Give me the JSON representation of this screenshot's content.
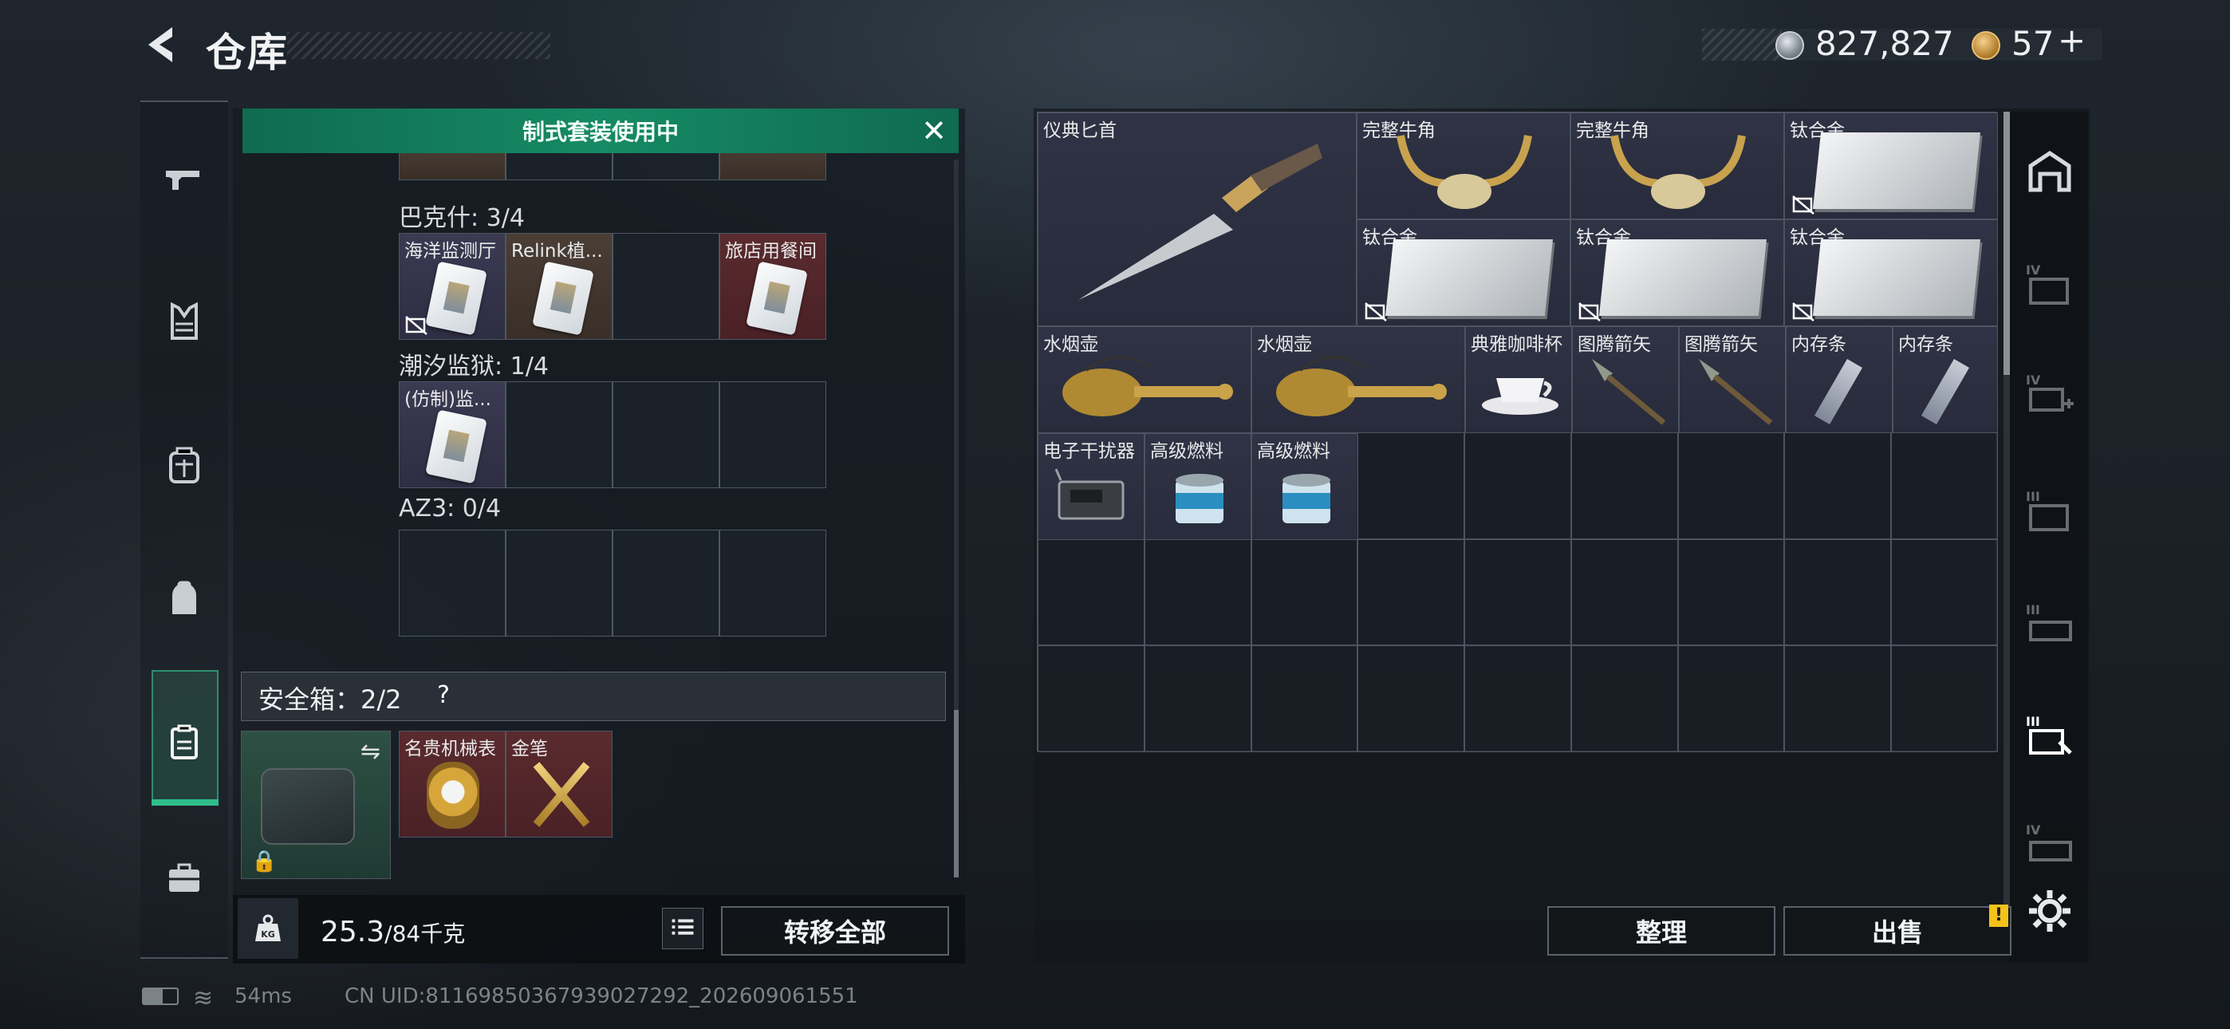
{
  "header": {
    "title": "仓库",
    "currency_silver": "827,827",
    "currency_gold": "57",
    "gold_plus": "+"
  },
  "banner": {
    "text": "制式套装使用中"
  },
  "sets": [
    {
      "label": "巴克什: 3/4",
      "items": [
        {
          "name": "海洋监测厅",
          "bg": "purple",
          "locked_off": true
        },
        {
          "name": "Relink植...",
          "bg": "brown"
        },
        {
          "name": "",
          "bg": "empty"
        },
        {
          "name": "旅店用餐间",
          "bg": "red"
        }
      ]
    },
    {
      "label": "潮汐监狱: 1/4",
      "items": [
        {
          "name": "(仿制)监...",
          "bg": "purple"
        },
        {
          "name": "",
          "bg": "empty"
        },
        {
          "name": "",
          "bg": "empty"
        },
        {
          "name": "",
          "bg": "empty"
        }
      ]
    },
    {
      "label": "AZ3: 0/4",
      "items": [
        {
          "name": "",
          "bg": "empty"
        },
        {
          "name": "",
          "bg": "empty"
        },
        {
          "name": "",
          "bg": "empty"
        },
        {
          "name": "",
          "bg": "empty"
        }
      ]
    }
  ],
  "safe_box": {
    "label": "安全箱：2/2",
    "help": "?",
    "items": [
      "名贵机械表",
      "金笔"
    ]
  },
  "weight": {
    "current": "25.3",
    "max": "/84千克"
  },
  "buttons": {
    "transfer_all": "转移全部",
    "sort": "整理",
    "sell": "出售"
  },
  "stash_items": [
    {
      "name": "仪典匕首"
    },
    {
      "name": "完整牛角"
    },
    {
      "name": "完整牛角"
    },
    {
      "name": "钛合金"
    },
    {
      "name": "钛合金"
    },
    {
      "name": "钛合金"
    },
    {
      "name": "钛合金"
    },
    {
      "name": "水烟壶"
    },
    {
      "name": "水烟壶"
    },
    {
      "name": "典雅咖啡杯"
    },
    {
      "name": "图腾箭矢"
    },
    {
      "name": "图腾箭矢"
    },
    {
      "name": "内存条"
    },
    {
      "name": "内存条"
    },
    {
      "name": "电子干扰器"
    },
    {
      "name": "高级燃料"
    },
    {
      "name": "高级燃料"
    }
  ],
  "right_nav": [
    "IV",
    "IV",
    "III",
    "III",
    "III",
    "IV"
  ],
  "footer": {
    "ping": "54ms",
    "uid": "CN UID:8116985036793902729​2_202609061551"
  }
}
